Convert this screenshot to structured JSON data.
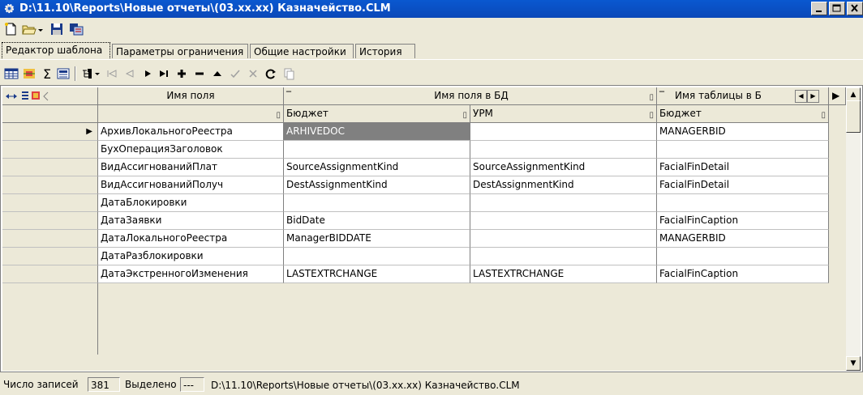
{
  "window": {
    "title": "D:\\11.10\\Reports\\Новые отчеты\\(03.xx.xx) Казначейство.CLM",
    "icon": "gear-icon",
    "buttons": [
      "minimize",
      "maximize",
      "close"
    ]
  },
  "toolbar": {
    "items": [
      "new-document-icon",
      "open-folder-icon",
      "dropdown-arrow-icon",
      "save-icon",
      "save-as-icon"
    ]
  },
  "tabs": [
    {
      "label": "Редактор шаблона",
      "active": true
    },
    {
      "label": "Параметры ограничения",
      "active": false
    },
    {
      "label": "Общие настройки",
      "active": false
    },
    {
      "label": "История",
      "active": false
    }
  ],
  "grid_toolbar": {
    "items": [
      "grid-icon",
      "fields-icon",
      "sum-icon",
      "calculator-icon",
      "tree-icon",
      "first-record-icon",
      "prev-record-icon",
      "next-record-icon",
      "last-record-icon",
      "add-record-icon",
      "delete-record-icon",
      "move-up-icon",
      "confirm-icon",
      "cancel-icon",
      "refresh-icon",
      "copy-icon"
    ],
    "sum_symbol": "Σ"
  },
  "grid": {
    "headers": {
      "field_name": "Имя поля",
      "db_field_name": "Имя поля в БД",
      "table_name": "Имя таблицы в Б"
    },
    "subheaders": [
      "Бюджет",
      "УРМ",
      "Бюджет"
    ],
    "rows": [
      {
        "field": "АрхивЛокальногоРеестра",
        "budget": "ARHIVEDOC",
        "urm": "",
        "table": "MANAGERBID",
        "current": true
      },
      {
        "field": "БухОперацияЗаголовок",
        "budget": "",
        "urm": "",
        "table": ""
      },
      {
        "field": "ВидАссигнованийПлат",
        "budget": "SourceAssignmentKind",
        "urm": "SourceAssignmentKind",
        "table": "FacialFinDetail"
      },
      {
        "field": "ВидАссигнованийПолуч",
        "budget": "DestAssignmentKind",
        "urm": "DestAssignmentKind",
        "table": "FacialFinDetail"
      },
      {
        "field": "ДатаБлокировки",
        "budget": "",
        "urm": "",
        "table": ""
      },
      {
        "field": "ДатаЗаявки",
        "budget": "BidDate",
        "urm": "",
        "table": "FacialFinCaption"
      },
      {
        "field": "ДатаЛокальногоРеестра",
        "budget": "ManagerBIDDATE",
        "urm": "",
        "table": "MANAGERBID"
      },
      {
        "field": "ДатаРазблокировки",
        "budget": "",
        "urm": "",
        "table": ""
      },
      {
        "field": "ДатаЭкстренногоИзменения",
        "budget": "LASTEXTRCHANGE",
        "urm": "LASTEXTRCHANGE",
        "table": "FacialFinCaption"
      }
    ]
  },
  "status": {
    "records_label": "Число записей",
    "records_value": "381",
    "selected_label": "Выделено",
    "selected_value": "---",
    "path": "D:\\11.10\\Reports\\Новые отчеты\\(03.xx.xx) Казначейство.CLM"
  },
  "colors": {
    "title_bar": "#0a58d0",
    "selected_cell": "#808080",
    "face": "#ece9d8"
  }
}
